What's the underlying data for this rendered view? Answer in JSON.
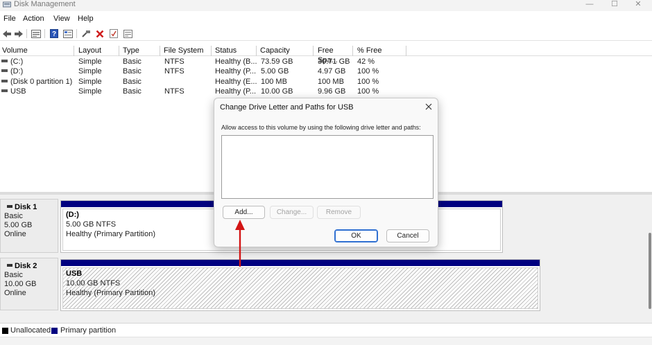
{
  "window": {
    "title": "Disk Management",
    "minimize": "—",
    "maximize": "☐",
    "close": "✕"
  },
  "menu": [
    "File",
    "Action",
    "View",
    "Help"
  ],
  "toolbar_icons": [
    "back-icon",
    "forward-icon",
    "disk-list-icon",
    "help-icon",
    "properties-icon",
    "connect-icon",
    "delete-icon",
    "check-icon",
    "settings-icon"
  ],
  "volume_table": {
    "columns": [
      "Volume",
      "Layout",
      "Type",
      "File System",
      "Status",
      "Capacity",
      "Free Spa...",
      "% Free"
    ],
    "rows": [
      [
        "(C:)",
        "Simple",
        "Basic",
        "NTFS",
        "Healthy (B...",
        "73.59 GB",
        "30.71 GB",
        "42 %"
      ],
      [
        "(D:)",
        "Simple",
        "Basic",
        "NTFS",
        "Healthy (P...",
        "5.00 GB",
        "4.97 GB",
        "100 %"
      ],
      [
        "(Disk 0 partition 1)",
        "Simple",
        "Basic",
        "",
        "Healthy (E...",
        "100 MB",
        "100 MB",
        "100 %"
      ],
      [
        "USB",
        "Simple",
        "Basic",
        "NTFS",
        "Healthy (P...",
        "10.00 GB",
        "9.96 GB",
        "100 %"
      ]
    ]
  },
  "disks": [
    {
      "name": "Disk 1",
      "type": "Basic",
      "size": "5.00 GB",
      "status": "Online",
      "partition": {
        "name": "(D:)",
        "info": "5.00 GB NTFS",
        "health": "Healthy (Primary Partition)"
      }
    },
    {
      "name": "Disk 2",
      "type": "Basic",
      "size": "10.00 GB",
      "status": "Online",
      "partition": {
        "name": "USB",
        "info": "10.00 GB NTFS",
        "health": "Healthy (Primary Partition)"
      }
    }
  ],
  "legend": {
    "unallocated": "Unallocated",
    "unallocated_color": "#000000",
    "primary": "Primary partition",
    "primary_color": "#000080"
  },
  "dialog": {
    "title": "Change Drive Letter and Paths for USB",
    "message": "Allow access to this volume by using the following drive letter and paths:",
    "add": "Add...",
    "change": "Change...",
    "remove": "Remove",
    "ok": "OK",
    "cancel": "Cancel"
  },
  "colors": {
    "accent": "#2f6fd1",
    "arrow": "#d31515",
    "partition_bar": "#000080"
  }
}
